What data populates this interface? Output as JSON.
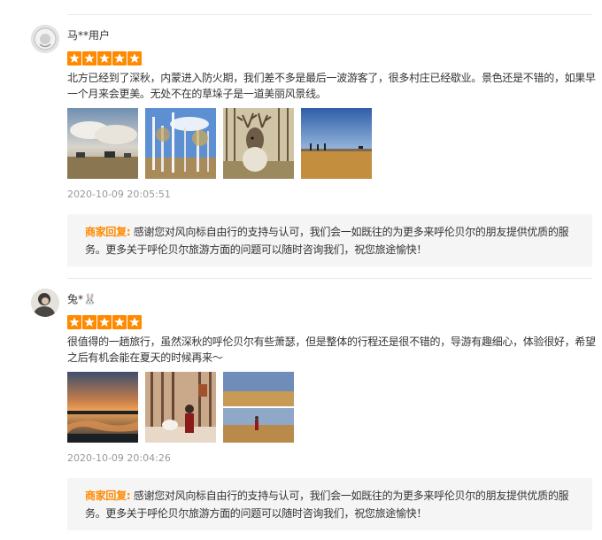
{
  "reviews": [
    {
      "username": "马**用户",
      "rating": 5,
      "text": "北方已经到了深秋，内蒙进入防火期，我们差不多是最后一波游客了，很多村庄已经歇业。景色还是不错的，如果早一个月来会更美。无处不在的草垛子是一道美丽风景线。",
      "photos": [
        "clouds-field-photo",
        "birch-trees-photo",
        "reindeer-photo",
        "grassland-sunset-photo"
      ],
      "date": "2020-10-09 20:05:51",
      "reply_label": "商家回复:",
      "reply_text": "感谢您对风向标自由行的支持与认可，我们会一如既往的为更多来呼伦贝尔的朋友提供优质的服务。更多关于呼伦贝尔旅游方面的问题可以随时咨询我们，祝您旅途愉快！"
    },
    {
      "username": "兔*🐰",
      "rating": 5,
      "text": "很值得的一趟旅行，虽然深秋的呼伦贝尔有些萧瑟，但是整体的行程还是很不错的，导游有趣细心，体验很好，希望之后有机会能在夏天的时候再来～",
      "photos": [
        "river-sunset-photo",
        "forest-girl-photo",
        "field-collage-photo"
      ],
      "date": "2020-10-09 20:04:26",
      "reply_label": "商家回复:",
      "reply_text": "感谢您对风向标自由行的支持与认可，我们会一如既往的为更多来呼伦贝尔的朋友提供优质的服务。更多关于呼伦贝尔旅游方面的问题可以随时咨询我们，祝您旅途愉快！"
    }
  ],
  "colors": {
    "star": "#ff8a00",
    "reply_label": "#ff8a00",
    "reply_bg": "#f5f5f5"
  }
}
